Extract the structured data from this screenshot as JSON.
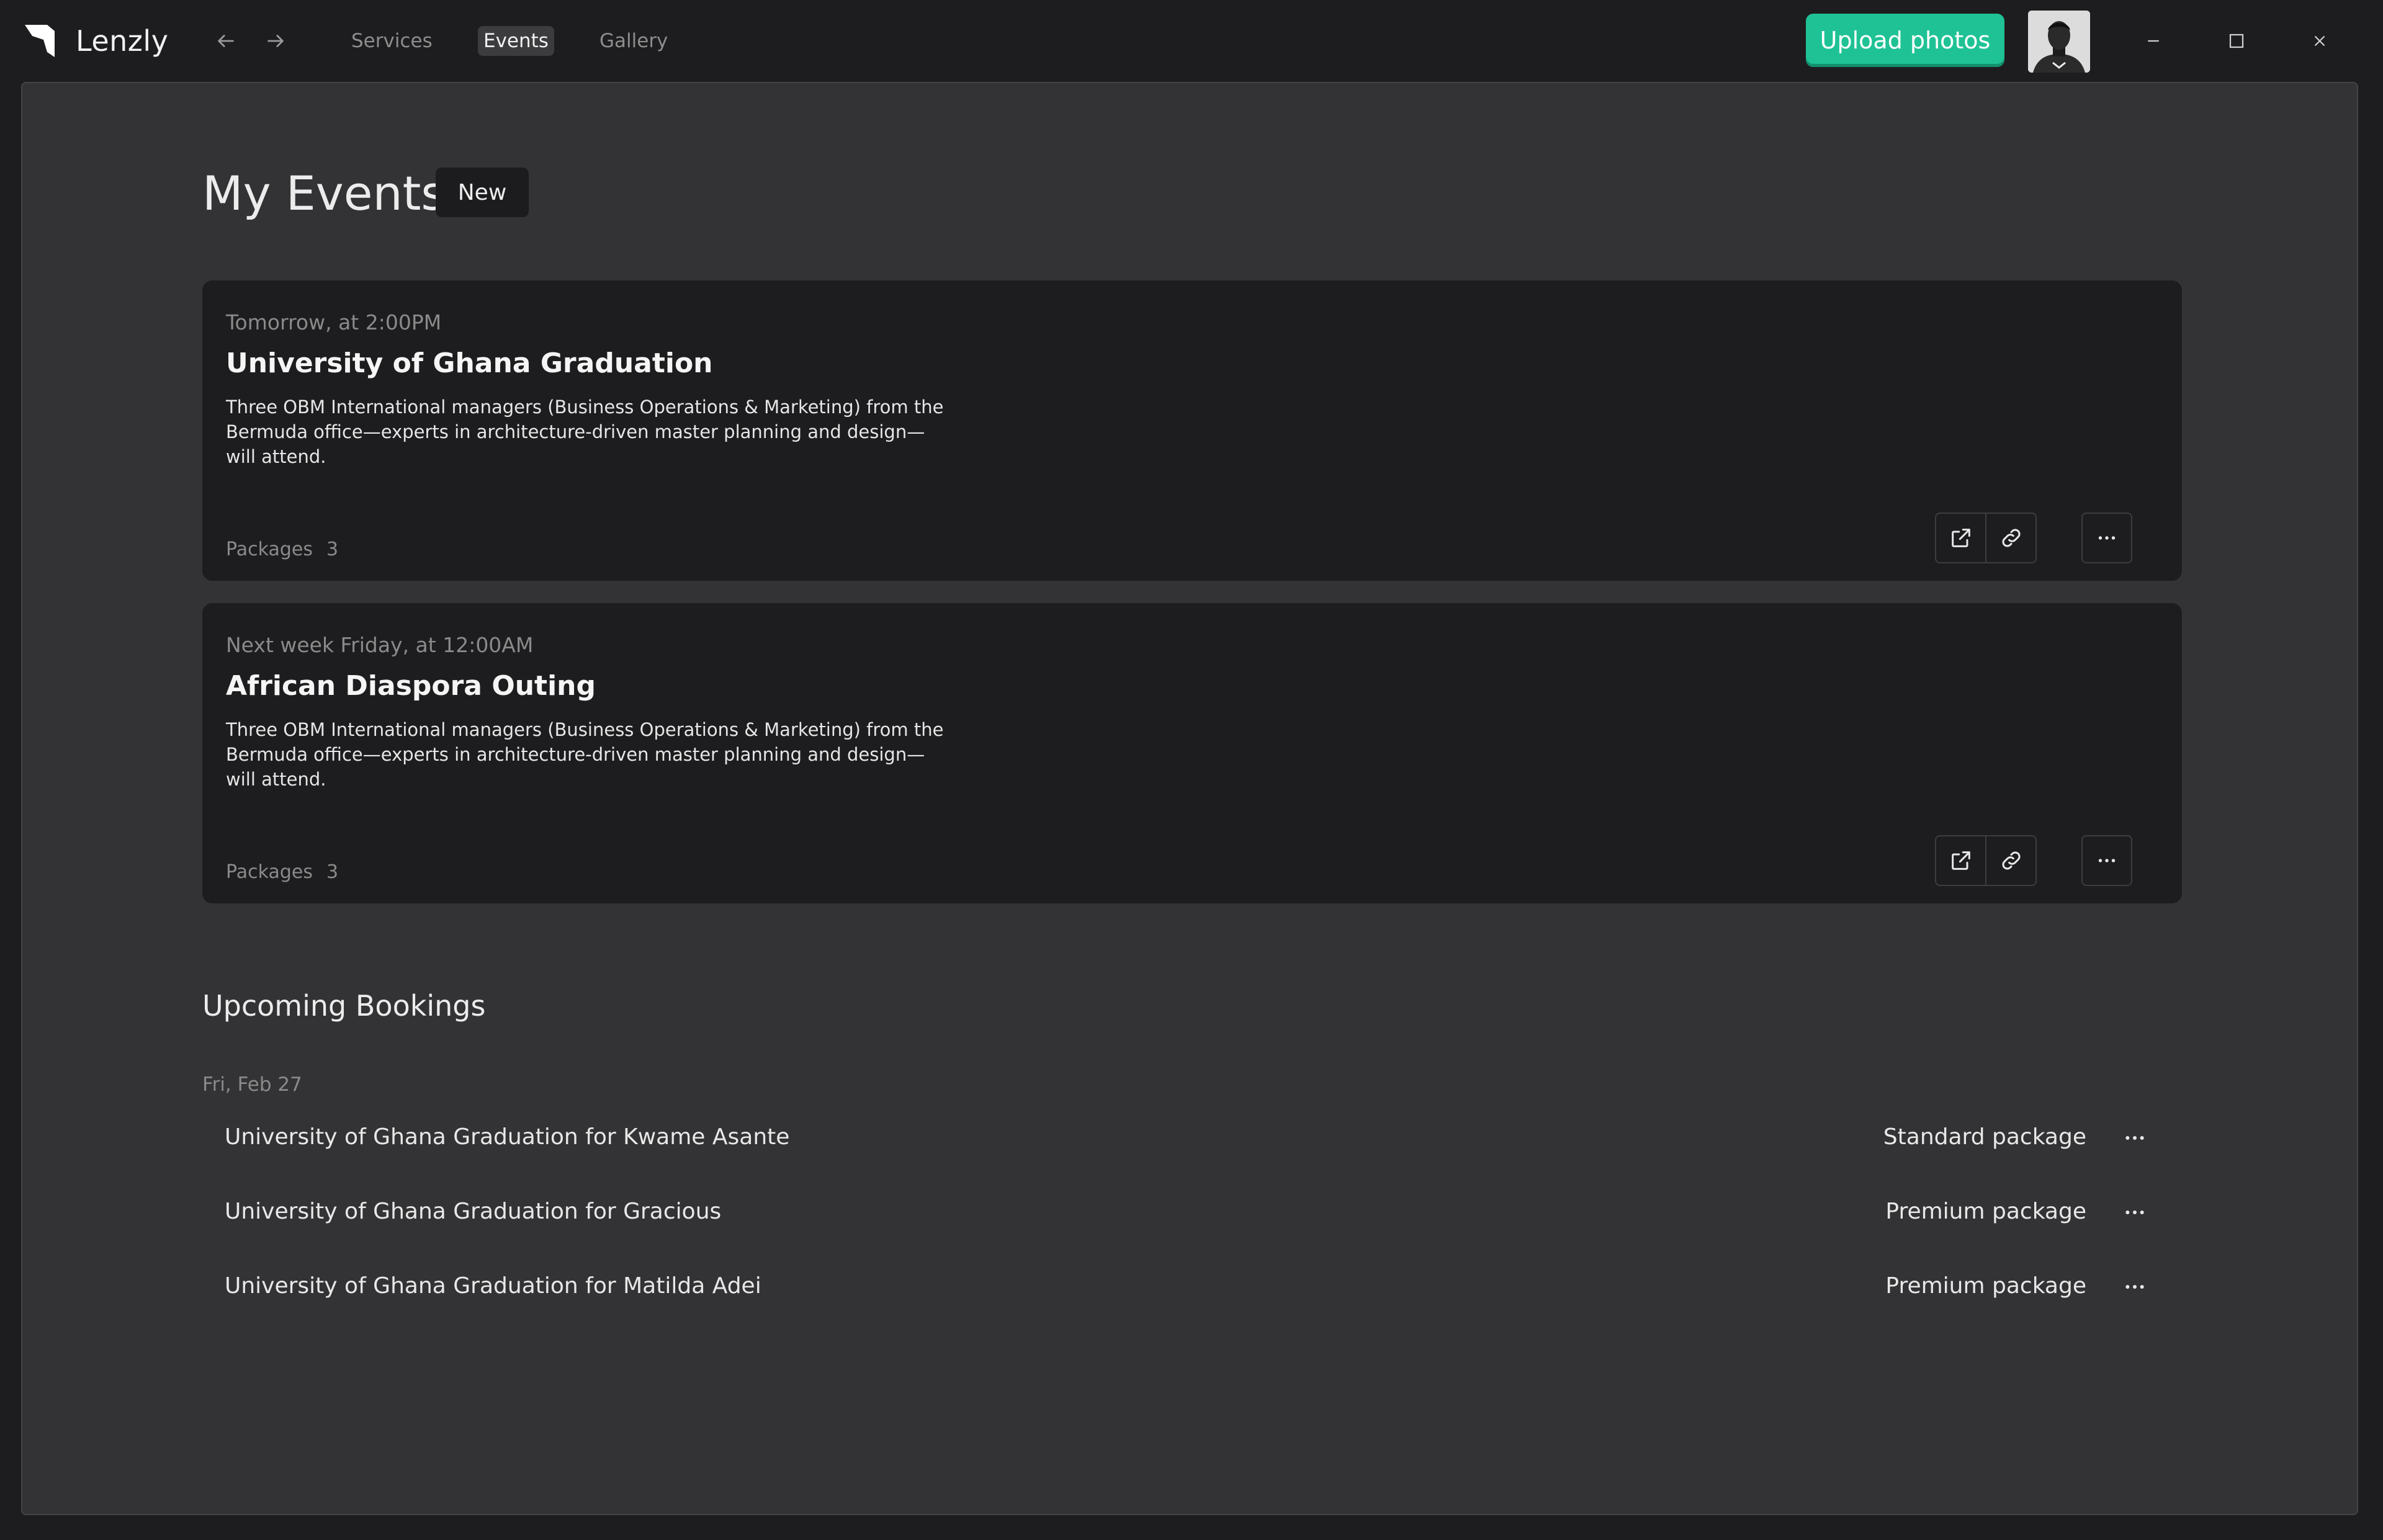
{
  "app": {
    "name": "Lenzly"
  },
  "nav": {
    "back_icon": "arrow-left-icon",
    "forward_icon": "arrow-right-icon",
    "links": [
      {
        "label": "Services",
        "active": false
      },
      {
        "label": "Events",
        "active": true
      },
      {
        "label": "Gallery",
        "active": false
      }
    ]
  },
  "header": {
    "upload_label": "Upload photos",
    "upload_color": "#1fc295"
  },
  "page": {
    "title": "My Events",
    "new_label": "New"
  },
  "events": [
    {
      "when": "Tomorrow, at 2:00PM",
      "title": "University of Ghana Graduation",
      "description": "Three OBM International managers (Business Operations & Marketing) from the Bermuda office—experts in architecture-driven master planning and design—will attend.",
      "packages_label": "Packages",
      "packages_count": "3"
    },
    {
      "when": "Next week Friday, at 12:00AM",
      "title": "African Diaspora Outing",
      "description": "Three OBM International managers (Business Operations & Marketing) from the Bermuda office—experts in architecture-driven master planning and design—will attend.",
      "packages_label": "Packages",
      "packages_count": "3"
    }
  ],
  "bookings": {
    "title": "Upcoming Bookings",
    "date": "Fri, Feb 27",
    "items": [
      {
        "name": "University of Ghana Graduation for Kwame Asante",
        "package": "Standard package"
      },
      {
        "name": "University of Ghana Graduation for Gracious",
        "package": "Premium package"
      },
      {
        "name": "University of Ghana Graduation for Matilda Adei",
        "package": "Premium package"
      }
    ]
  },
  "colors": {
    "background": "#1d1d1f",
    "panel": "#333335",
    "card": "#1d1d1f",
    "accent": "#1fc295"
  }
}
